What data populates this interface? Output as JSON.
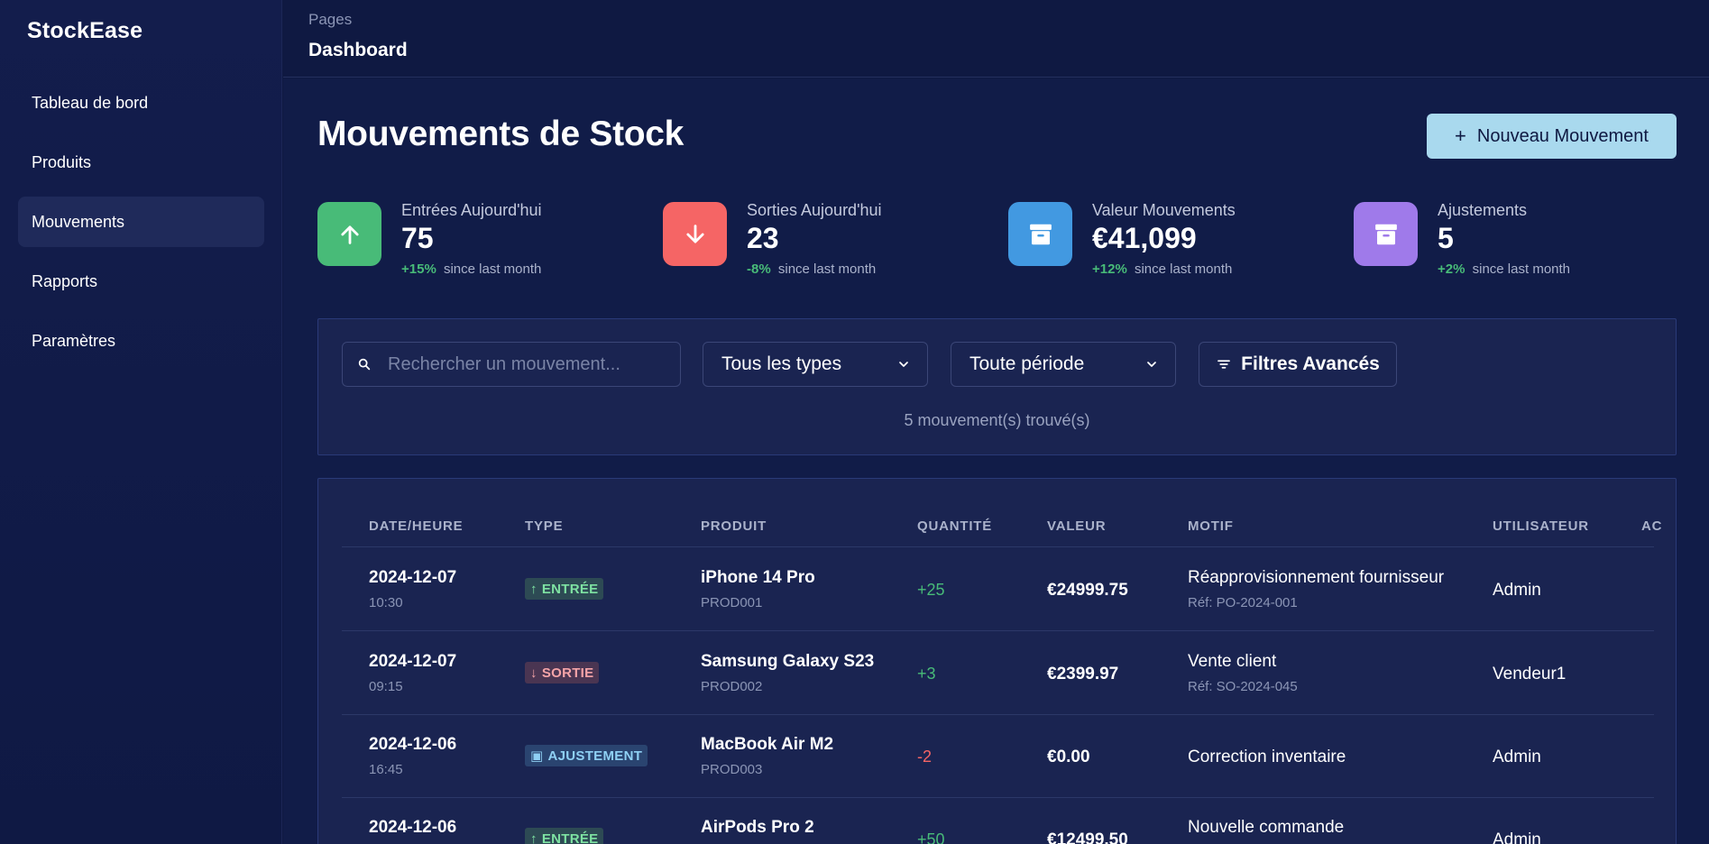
{
  "app": {
    "brand": "StockEase"
  },
  "sidebar": {
    "items": [
      {
        "label": "Tableau de bord"
      },
      {
        "label": "Produits"
      },
      {
        "label": "Mouvements",
        "active": true
      },
      {
        "label": "Rapports"
      },
      {
        "label": "Paramètres"
      }
    ]
  },
  "header": {
    "breadcrumb": "Pages",
    "title": "Dashboard"
  },
  "page": {
    "title": "Mouvements de Stock",
    "new_button": "Nouveau Mouvement",
    "new_button_icon": "+"
  },
  "stats": [
    {
      "label": "Entrées Aujourd'hui",
      "value": "75",
      "delta": "+15%",
      "since": "since last month",
      "icon": "arrow-up-icon",
      "color": "#48bb78"
    },
    {
      "label": "Sorties Aujourd'hui",
      "value": "23",
      "delta": "-8%",
      "since": "since last month",
      "icon": "arrow-down-icon",
      "color": "#f56565"
    },
    {
      "label": "Valeur Mouvements",
      "value": "€41,099",
      "delta": "+12%",
      "since": "since last month",
      "icon": "archive-icon",
      "color": "#4299e1"
    },
    {
      "label": "Ajustements",
      "value": "5",
      "delta": "+2%",
      "since": "since last month",
      "icon": "archive-icon",
      "color": "#9f7aea"
    }
  ],
  "filters": {
    "search_placeholder": "Rechercher un mouvement...",
    "type_select": "Tous les types",
    "period_select": "Toute période",
    "advanced": "Filtres Avancés",
    "count": "5 mouvement(s) trouvé(s)"
  },
  "table": {
    "columns": [
      "DATE/HEURE",
      "TYPE",
      "PRODUIT",
      "QUANTITÉ",
      "VALEUR",
      "MOTIF",
      "UTILISATEUR",
      "AC"
    ],
    "rows": [
      {
        "date": "2024-12-07",
        "time": "10:30",
        "type": "ENTRÉE",
        "type_icon": "↑",
        "product": "iPhone 14 Pro",
        "sku": "PROD001",
        "qty": "+25",
        "value": "€24999.75",
        "motif": "Réapprovisionnement fournisseur",
        "ref": "Réf: PO-2024-001",
        "user": "Admin"
      },
      {
        "date": "2024-12-07",
        "time": "09:15",
        "type": "SORTIE",
        "type_icon": "↓",
        "product": "Samsung Galaxy S23",
        "sku": "PROD002",
        "qty": "+3",
        "value": "€2399.97",
        "motif": "Vente client",
        "ref": "Réf: SO-2024-045",
        "user": "Vendeur1"
      },
      {
        "date": "2024-12-06",
        "time": "16:45",
        "type": "AJUSTEMENT",
        "type_icon": "▣",
        "product": "MacBook Air M2",
        "sku": "PROD003",
        "qty": "-2",
        "value": "€0.00",
        "motif": "Correction inventaire",
        "ref": "",
        "user": "Admin"
      },
      {
        "date": "2024-12-06",
        "time": "",
        "type": "ENTRÉE",
        "type_icon": "↑",
        "product": "AirPods Pro 2",
        "sku": "",
        "qty": "+50",
        "value": "€12499.50",
        "motif": "Nouvelle commande",
        "ref": "",
        "user": "Admin"
      }
    ]
  }
}
